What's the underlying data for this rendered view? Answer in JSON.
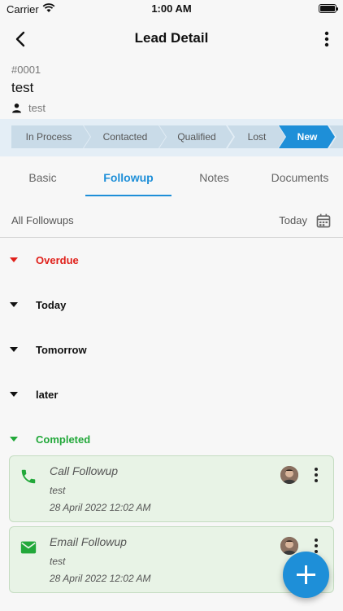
{
  "status_bar": {
    "carrier": "Carrier",
    "time": "1:00 AM"
  },
  "nav": {
    "title": "Lead Detail"
  },
  "lead": {
    "id": "#0001",
    "name": "test",
    "owner": "test"
  },
  "stages": [
    {
      "label": "In Process",
      "active": false
    },
    {
      "label": "Contacted",
      "active": false
    },
    {
      "label": "Qualified",
      "active": false
    },
    {
      "label": "Lost",
      "active": false
    },
    {
      "label": "New",
      "active": true
    }
  ],
  "tabs": [
    {
      "label": "Basic"
    },
    {
      "label": "Followup"
    },
    {
      "label": "Notes"
    },
    {
      "label": "Documents"
    }
  ],
  "active_tab": "Followup",
  "filter": {
    "label": "All Followups",
    "date": "Today"
  },
  "groups": [
    {
      "name": "Overdue",
      "color": "#e0201a"
    },
    {
      "name": "Today",
      "color": "#111111"
    },
    {
      "name": "Tomorrow",
      "color": "#111111"
    },
    {
      "name": "later",
      "color": "#111111"
    },
    {
      "name": "Completed",
      "color": "#22a83a"
    }
  ],
  "followups": [
    {
      "title": "Call Followup",
      "note": "test",
      "date": "28 April 2022 12:02 AM",
      "type": "phone-icon"
    },
    {
      "title": "Email Followup",
      "note": "test",
      "date": "28 April 2022 12:02 AM",
      "type": "email-icon"
    }
  ],
  "colors": {
    "accent": "#1e8fd8",
    "completed": "#22a83a",
    "overdue": "#e0201a",
    "card_bg": "#e8f3e6"
  }
}
